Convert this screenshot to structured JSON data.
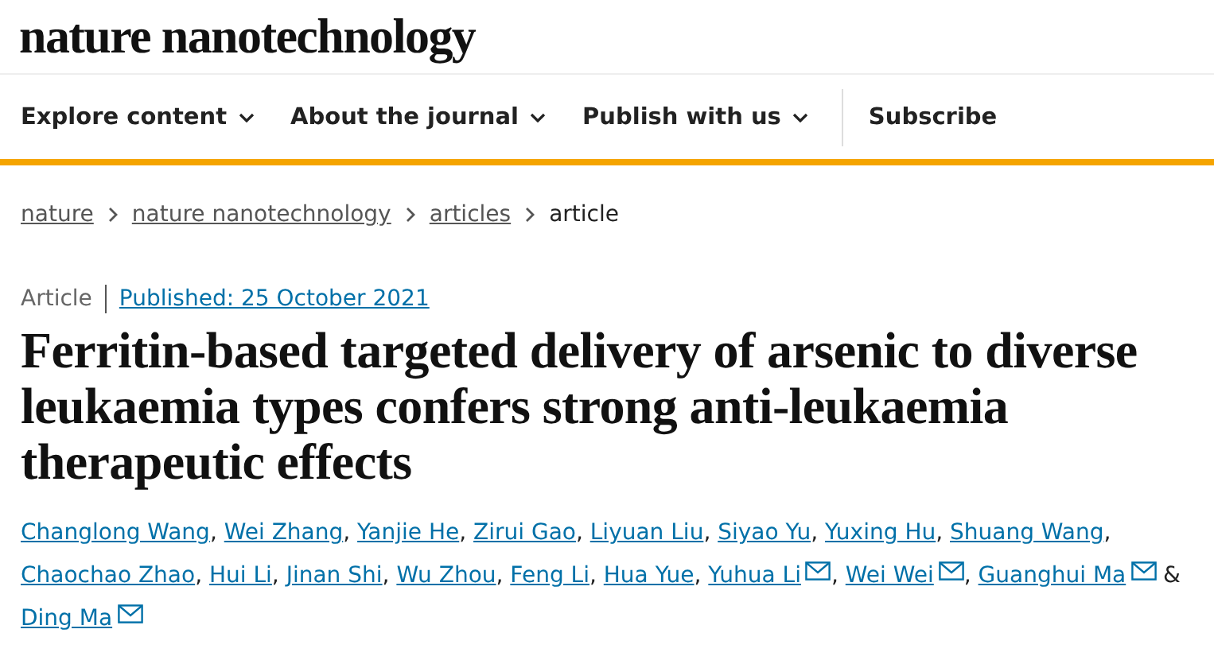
{
  "logo": "nature nanotechnology",
  "nav": [
    {
      "label": "Explore content",
      "dropdown": true
    },
    {
      "label": "About the journal",
      "dropdown": true
    },
    {
      "label": "Publish with us",
      "dropdown": true
    },
    {
      "label": "Subscribe",
      "dropdown": false
    }
  ],
  "breadcrumbs": [
    {
      "label": "nature",
      "link": true
    },
    {
      "label": "nature nanotechnology",
      "link": true
    },
    {
      "label": "articles",
      "link": true
    },
    {
      "label": "article",
      "link": false
    }
  ],
  "article_type": "Article",
  "published": "Published: 25 October 2021",
  "title": "Ferritin-based targeted delivery of arsenic to diverse leukaemia types confers strong anti-leukaemia therapeutic effects",
  "authors": [
    {
      "name": "Changlong Wang",
      "contact": false,
      "after": ","
    },
    {
      "name": "Wei Zhang",
      "contact": false,
      "after": ","
    },
    {
      "name": "Yanjie He",
      "contact": false,
      "after": ","
    },
    {
      "name": "Zirui Gao",
      "contact": false,
      "after": ","
    },
    {
      "name": "Liyuan Liu",
      "contact": false,
      "after": ","
    },
    {
      "name": "Siyao Yu",
      "contact": false,
      "after": ","
    },
    {
      "name": "Yuxing Hu",
      "contact": false,
      "after": ","
    },
    {
      "name": "Shuang Wang",
      "contact": false,
      "after": ","
    },
    {
      "name": "Chaochao Zhao",
      "contact": false,
      "after": ","
    },
    {
      "name": "Hui Li",
      "contact": false,
      "after": ","
    },
    {
      "name": "Jinan Shi",
      "contact": false,
      "after": ","
    },
    {
      "name": "Wu Zhou",
      "contact": false,
      "after": ","
    },
    {
      "name": "Feng Li",
      "contact": false,
      "after": ","
    },
    {
      "name": "Hua Yue",
      "contact": false,
      "after": ","
    },
    {
      "name": "Yuhua Li",
      "contact": true,
      "after": ","
    },
    {
      "name": "Wei Wei",
      "contact": true,
      "after": ","
    },
    {
      "name": "Guanghui Ma",
      "contact": true,
      "after": " &"
    },
    {
      "name": "Ding Ma",
      "contact": true
    }
  ]
}
